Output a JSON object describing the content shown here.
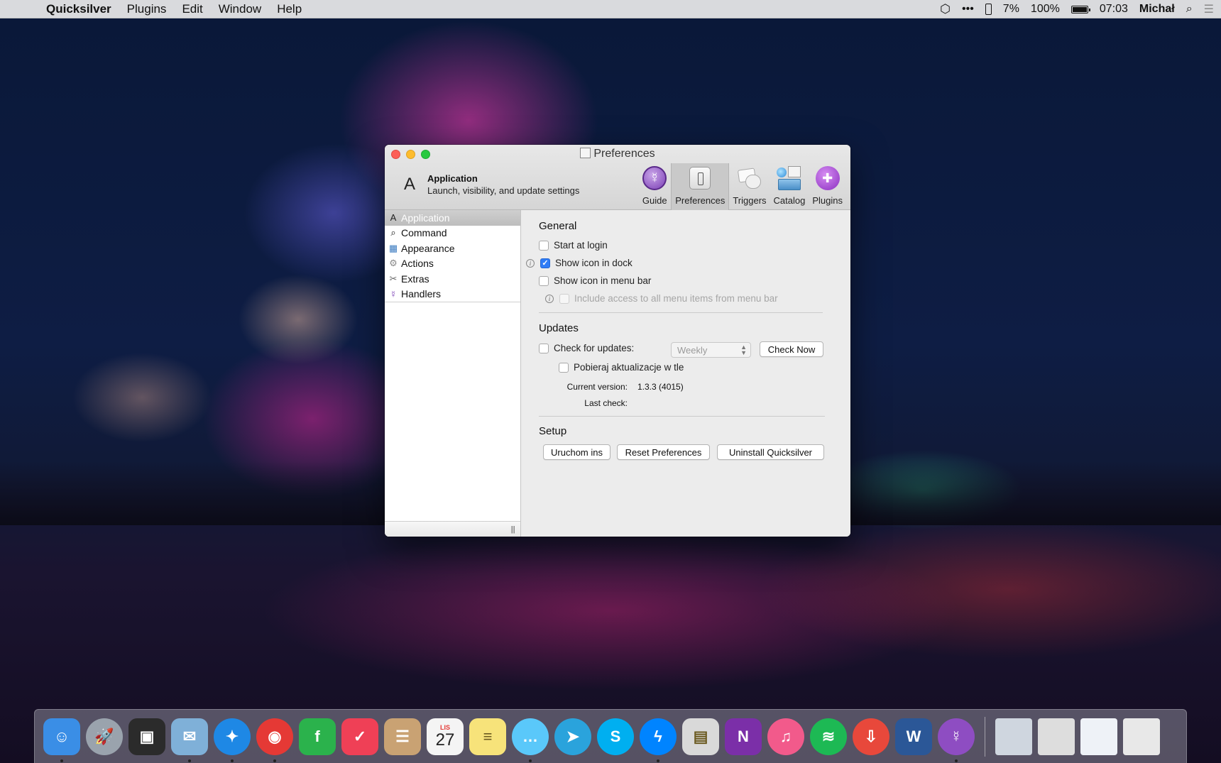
{
  "menubar": {
    "app_name": "Quicksilver",
    "items": [
      "Plugins",
      "Edit",
      "Window",
      "Help"
    ],
    "status": {
      "dots": "•••",
      "percent_small": "7%",
      "battery": "100%",
      "battery_level": 1.0,
      "time": "07:03",
      "user": "Michał"
    }
  },
  "window": {
    "title": "Preferences",
    "header": {
      "title": "Application",
      "subtitle": "Launch, visibility, and update settings"
    },
    "toolbar": [
      {
        "label": "Guide",
        "icon": "guide-icon"
      },
      {
        "label": "Preferences",
        "icon": "preferences-icon",
        "active": true
      },
      {
        "label": "Triggers",
        "icon": "triggers-icon"
      },
      {
        "label": "Catalog",
        "icon": "catalog-icon"
      },
      {
        "label": "Plugins",
        "icon": "plugins-icon"
      }
    ],
    "sidebar": [
      {
        "label": "Application",
        "icon": "application-icon",
        "selected": true
      },
      {
        "label": "Command",
        "icon": "magnifier-icon"
      },
      {
        "label": "Appearance",
        "icon": "appearance-icon"
      },
      {
        "label": "Actions",
        "icon": "gear-icon"
      },
      {
        "label": "Extras",
        "icon": "tools-icon"
      },
      {
        "label": "Handlers",
        "icon": "handlers-icon"
      }
    ],
    "general": {
      "title": "General",
      "start_at_login": {
        "label": "Start at login",
        "checked": false
      },
      "show_icon_in_dock": {
        "label": "Show icon in dock",
        "checked": true
      },
      "show_icon_in_menu_bar": {
        "label": "Show icon in menu bar",
        "checked": false
      },
      "include_access": {
        "label": "Include access to all menu items from menu bar",
        "checked": false,
        "enabled": false
      }
    },
    "updates": {
      "title": "Updates",
      "check_for_updates": {
        "label": "Check for updates:",
        "checked": false
      },
      "frequency": "Weekly",
      "check_now": "Check Now",
      "download_background": {
        "label": "Pobieraj aktualizacje w tle",
        "checked": false
      },
      "current_version_label": "Current version:",
      "current_version": "1.3.3 (4015)",
      "last_check_label": "Last check:",
      "last_check": ""
    },
    "setup": {
      "title": "Setup",
      "buttons": [
        "Uruchom ins",
        "Reset Preferences",
        "Uninstall Quicksilver"
      ]
    }
  },
  "dock": {
    "apps": [
      {
        "name": "Finder",
        "bg": "#3a8ee6",
        "running": true
      },
      {
        "name": "Launchpad",
        "bg": "#9aa3ad",
        "running": false
      },
      {
        "name": "Photo Booth",
        "bg": "#2b2b2b",
        "running": false
      },
      {
        "name": "Mail",
        "bg": "#7fb0d8",
        "running": true
      },
      {
        "name": "Safari",
        "bg": "#1e88e5",
        "running": true
      },
      {
        "name": "Chrome",
        "bg": "#e53935",
        "running": true
      },
      {
        "name": "Feedly",
        "bg": "#2bb24c",
        "running": false
      },
      {
        "name": "Pocket",
        "bg": "#ef4056",
        "running": false
      },
      {
        "name": "Contacts",
        "bg": "#c9a273",
        "running": false
      },
      {
        "name": "Calendar",
        "bg": "#f4f4f4",
        "running": false,
        "month": "LIS",
        "day": "27"
      },
      {
        "name": "Notes",
        "bg": "#f7e37a",
        "running": false
      },
      {
        "name": "Messages",
        "bg": "#5ac8fa",
        "running": true
      },
      {
        "name": "Telegram",
        "bg": "#2aa3dc",
        "running": false
      },
      {
        "name": "Skype",
        "bg": "#00aff0",
        "running": false
      },
      {
        "name": "Messenger",
        "bg": "#0084ff",
        "running": true
      },
      {
        "name": "Preview",
        "bg": "#d9d9d9",
        "running": false
      },
      {
        "name": "OneNote",
        "bg": "#7b2fa8",
        "running": false
      },
      {
        "name": "iTunes",
        "bg": "#f25a8b",
        "running": false
      },
      {
        "name": "Spotify",
        "bg": "#1db954",
        "running": false
      },
      {
        "name": "Transmit",
        "bg": "#e8483b",
        "running": false
      },
      {
        "name": "Word",
        "bg": "#2b5797",
        "running": false
      },
      {
        "name": "Quicksilver",
        "bg": "#8e4dc2",
        "running": true
      }
    ],
    "others": [
      {
        "name": "Downloads",
        "bg": "#cfd6df"
      },
      {
        "name": "Documents",
        "bg": "#dddddd"
      },
      {
        "name": "Desktop",
        "bg": "#eef2f7"
      },
      {
        "name": "Trash",
        "bg": "#e8e8e8"
      }
    ]
  }
}
